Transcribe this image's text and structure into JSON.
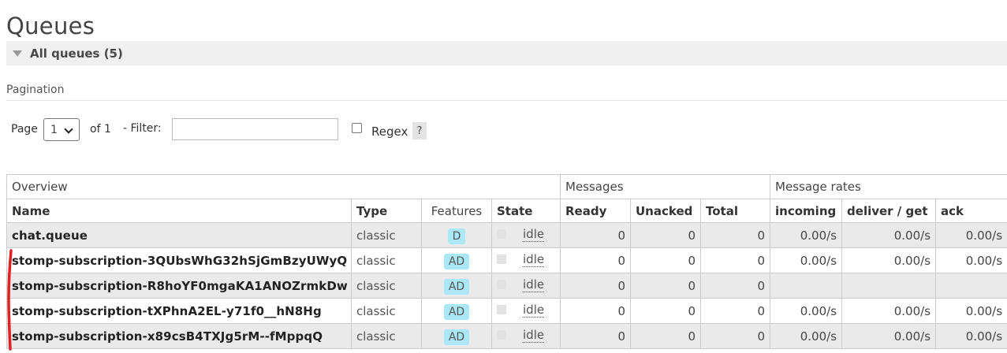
{
  "page_title": "Queues",
  "section": {
    "title": "All queues (5)"
  },
  "pagination": {
    "heading": "Pagination",
    "page_label": "Page",
    "page_value": "1",
    "of_label": "of 1",
    "filter_label": "- Filter:",
    "filter_value": "",
    "regex_label": "Regex",
    "help_label": "?"
  },
  "table": {
    "groups": [
      "Overview",
      "Messages",
      "Message rates"
    ],
    "columns": [
      "Name",
      "Type",
      "Features",
      "State",
      "Ready",
      "Unacked",
      "Total",
      "incoming",
      "deliver / get",
      "ack"
    ],
    "rows": [
      {
        "name": "chat.queue",
        "type": "classic",
        "features": "D",
        "state": "idle",
        "ready": "0",
        "unacked": "0",
        "total": "0",
        "incoming": "0.00/s",
        "deliver_get": "0.00/s",
        "ack": "0.00/s"
      },
      {
        "name": "stomp-subscription-3QUbsWhG32hSjGmBzyUWyQ",
        "type": "classic",
        "features": "AD",
        "state": "idle",
        "ready": "0",
        "unacked": "0",
        "total": "0",
        "incoming": "0.00/s",
        "deliver_get": "0.00/s",
        "ack": "0.00/s"
      },
      {
        "name": "stomp-subscription-R8hoYF0mgaKA1ANOZrmkDw",
        "type": "classic",
        "features": "AD",
        "state": "idle",
        "ready": "0",
        "unacked": "0",
        "total": "0",
        "incoming": "",
        "deliver_get": "",
        "ack": ""
      },
      {
        "name": "stomp-subscription-tXPhnA2EL-y71f0__hN8Hg",
        "type": "classic",
        "features": "AD",
        "state": "idle",
        "ready": "0",
        "unacked": "0",
        "total": "0",
        "incoming": "0.00/s",
        "deliver_get": "0.00/s",
        "ack": "0.00/s"
      },
      {
        "name": "stomp-subscription-x89csB4TXJg5rM--fMppqQ",
        "type": "classic",
        "features": "AD",
        "state": "idle",
        "ready": "0",
        "unacked": "0",
        "total": "0",
        "incoming": "0.00/s",
        "deliver_get": "0.00/s",
        "ack": "0.00/s"
      }
    ]
  },
  "colors": {
    "feature_badge": "#aae8f7",
    "odd_row": "#eaeaea",
    "annotation_mark": "#e02020"
  }
}
